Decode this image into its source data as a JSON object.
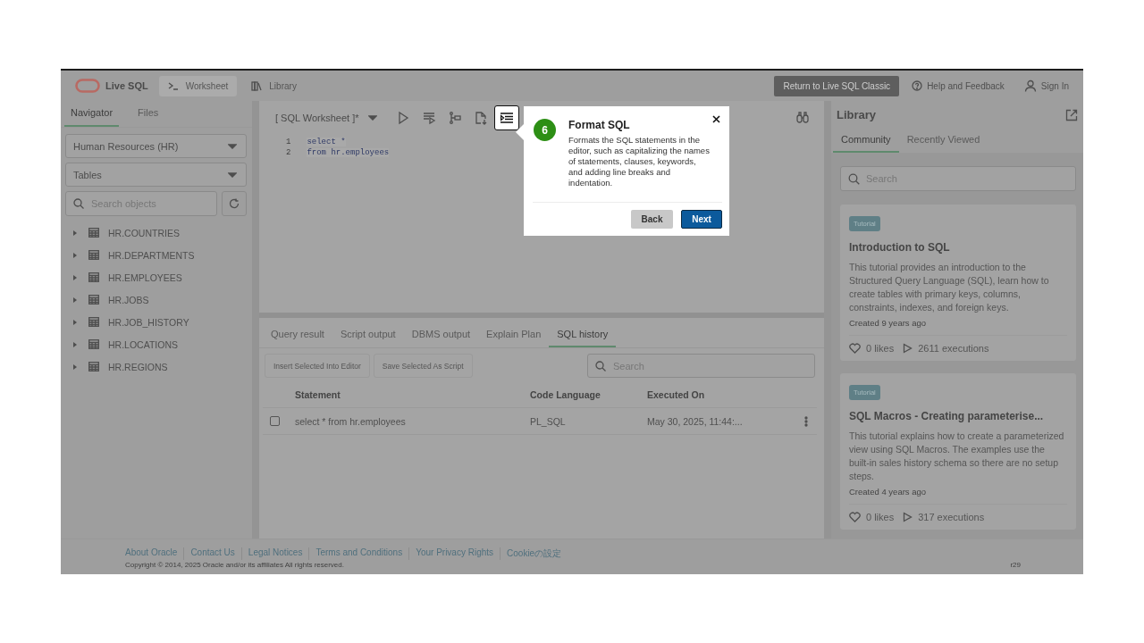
{
  "header": {
    "logo_text": "Live SQL",
    "nav": [
      {
        "label": "Worksheet",
        "selected": true
      },
      {
        "label": "Library",
        "selected": false
      }
    ],
    "return_button": "Return to Live SQL Classic",
    "help_link": "Help and Feedback",
    "sign_in": "Sign In"
  },
  "navigator": {
    "tabs": [
      {
        "label": "Navigator",
        "selected": true
      },
      {
        "label": "Files",
        "selected": false
      }
    ],
    "schema_select": "Human Resources (HR)",
    "type_select": "Tables",
    "search": {
      "placeholder": "Search objects"
    },
    "tables": [
      {
        "name": "HR.COUNTRIES",
        "expanded": false
      },
      {
        "name": "HR.DEPARTMENTS",
        "expanded": false
      },
      {
        "name": "HR.EMPLOYEES",
        "expanded": false
      },
      {
        "name": "HR.JOBS",
        "expanded": false
      },
      {
        "name": "HR.JOB_HISTORY",
        "expanded": false
      },
      {
        "name": "HR.LOCATIONS",
        "expanded": false
      },
      {
        "name": "HR.REGIONS",
        "expanded": false
      }
    ]
  },
  "worksheet": {
    "title": "[ SQL Worksheet ]*",
    "toolbar": [
      {
        "kind": "run",
        "highlighted": false
      },
      {
        "kind": "script",
        "highlighted": false
      },
      {
        "kind": "plan",
        "highlighted": false
      },
      {
        "kind": "download",
        "highlighted": false
      },
      {
        "kind": "format",
        "highlighted": true
      }
    ],
    "editor": [
      {
        "number": "1",
        "code": "select *"
      },
      {
        "number": "2",
        "code": "from hr.employees"
      }
    ]
  },
  "results": {
    "tabs": [
      {
        "label": "Query result",
        "selected": false
      },
      {
        "label": "Script output",
        "selected": false
      },
      {
        "label": "DBMS output",
        "selected": false
      },
      {
        "label": "Explain Plan",
        "selected": false
      },
      {
        "label": "SQL history",
        "selected": true
      }
    ],
    "buttons": [
      {
        "label": "Insert Selected Into Editor",
        "disabled": true
      },
      {
        "label": "Save Selected As Script",
        "disabled": true
      }
    ],
    "search": {
      "placeholder": "Search"
    },
    "table": {
      "columns": [
        "Statement",
        "Code Language",
        "Executed On"
      ],
      "rows": [
        {
          "checked": false,
          "statement": "select * from hr.employees",
          "language": "PL_SQL",
          "executed": "May 30, 2025, 11:44:..."
        }
      ]
    }
  },
  "library": {
    "title": "Library",
    "tabs": [
      {
        "label": "Community",
        "selected": true
      },
      {
        "label": "Recently Viewed",
        "selected": false
      }
    ],
    "search": {
      "placeholder": "Search"
    },
    "cards": [
      {
        "tag": "Tutorial",
        "title": "Introduction to SQL",
        "description": "This tutorial provides an introduction to the Structured Query Language (SQL), learn how to create tables with primary keys, columns, constraints, indexes, and foreign keys.",
        "created": "Created 9 years ago",
        "likes": "0 likes",
        "executions": "2611 executions"
      },
      {
        "tag": "Tutorial",
        "title": "SQL Macros - Creating parameterise...",
        "description": "This tutorial explains how to create a parameterized view using SQL Macros. The examples use the built-in sales history schema so there are no setup steps.",
        "created": "Created 4 years ago",
        "likes": "0 likes",
        "executions": "317 executions"
      }
    ]
  },
  "footer": {
    "links": [
      "About Oracle",
      "Contact Us",
      "Legal Notices",
      "Terms and Conditions",
      "Your Privacy Rights",
      "Cookieの設定"
    ],
    "copyright": "Copyright © 2014, 2025 Oracle and/or its affiliates All rights reserved.",
    "version": "r29"
  },
  "tour": {
    "step": "6",
    "title": "Format SQL",
    "text": "Formats the SQL statements in the editor, such as capitalizing the names of statements, clauses, keywords, and adding line breaks and indentation.",
    "buttons": [
      {
        "kind": "back",
        "label": "Back"
      },
      {
        "kind": "next",
        "label": "Next"
      }
    ]
  }
}
